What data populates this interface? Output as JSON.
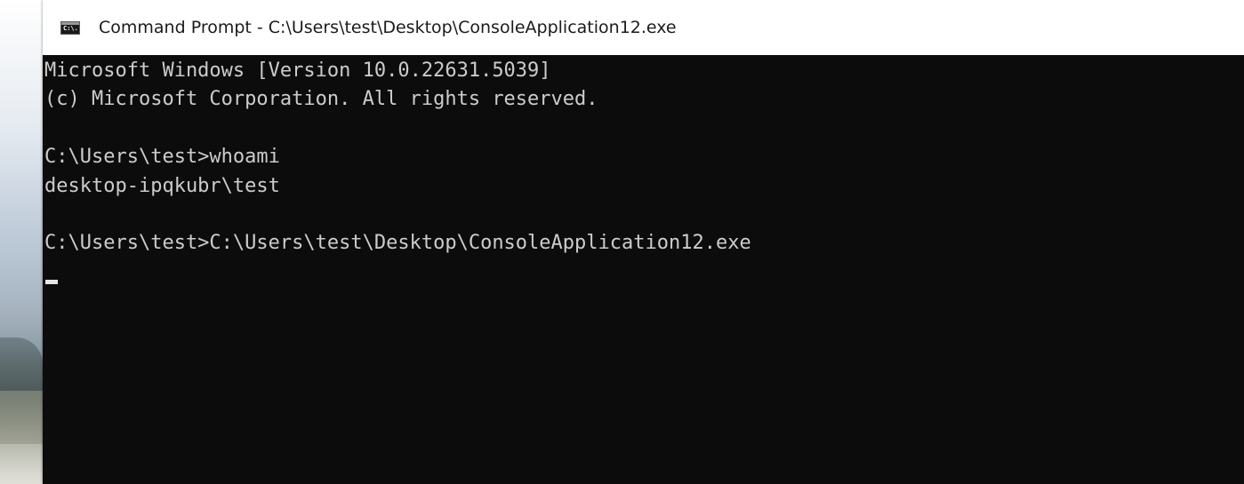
{
  "window": {
    "title": "Command Prompt - C:\\Users\\test\\Desktop\\ConsoleApplication12.exe",
    "icon": "cmd-icon",
    "icon_glyph": "C:\\."
  },
  "console": {
    "lines": [
      "Microsoft Windows [Version 10.0.22631.5039]",
      "(c) Microsoft Corporation. All rights reserved.",
      "C:\\Users\\test>whoami",
      "desktop-ipqkubr\\test",
      "C:\\Users\\test>C:\\Users\\test\\Desktop\\ConsoleApplication12.exe"
    ],
    "colors": {
      "background": "#0c0c0c",
      "text": "#cccccc",
      "cursor": "#e6e6e6"
    }
  }
}
